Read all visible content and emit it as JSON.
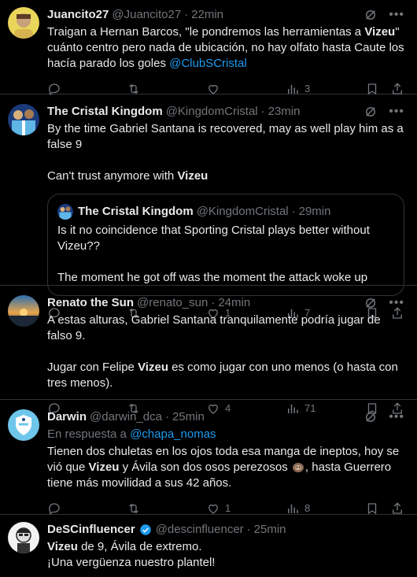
{
  "tweets": [
    {
      "name": "Juancito27",
      "handle": "@Juancito27",
      "dot": "·",
      "time": "22min",
      "text_before": "Traigan a Hernan Barcos, \"le pondremos las herramientas a ",
      "bold1": "Vizeu",
      "text_after": "\" cuánto centro pero nada de ubicación, no hay olfato hasta Caute los hacía parado los goles ",
      "link": "@ClubSCristal",
      "replies": "",
      "retweets": "",
      "likes": "",
      "views": "3"
    },
    {
      "name": "The Cristal Kingdom",
      "handle": "@KingdomCristal",
      "dot": "·",
      "time": "23min",
      "line1": "By the time Gabriel Santana is recovered, may as well play him as a false 9",
      "line2_before": "Can't trust anymore with ",
      "line2_bold": "Vizeu",
      "quote": {
        "name": "The Cristal Kingdom",
        "handle": "@KingdomCristal",
        "dot": "·",
        "time": "29min",
        "line1": "Is it no coincidence that Sporting Cristal plays better without Vizeu??",
        "line2": "The moment he got off was the moment the attack woke up"
      },
      "replies": "",
      "retweets": "",
      "likes": "1",
      "views": "7"
    },
    {
      "name": "Renato the Sun",
      "handle": "@renato_sun",
      "dot": "·",
      "time": "24min",
      "line1": "A estas alturas, Gabriel Santana tranquilamente podría jugar de falso 9.",
      "line2_before": "Jugar con Felipe ",
      "line2_bold": "Vizeu",
      "line2_after": " es como jugar con uno menos (o hasta con tres menos).",
      "replies": "",
      "retweets": "",
      "likes": "4",
      "views": "71"
    },
    {
      "name": "Darwin",
      "handle": "@darwin_dca",
      "dot": "·",
      "time": "25min",
      "reply_label": "En respuesta a ",
      "reply_handle": "@chapa_nomas",
      "text1": "Tienen dos chuletas en los ojos toda esa manga de ineptos, hoy se vió que ",
      "bold1": "Vizeu",
      "text2": " y Ávila son dos osos perezosos ",
      "text3": ", hasta Guerrero tiene más movilidad a sus 42 años.",
      "replies": "",
      "retweets": "",
      "likes": "1",
      "views": "8"
    },
    {
      "name": "DeSCinfluencer",
      "handle": "@descinfluencer",
      "dot": "·",
      "time": "25min",
      "bold1": "Vizeu",
      "text1": " de 9, Ávila de extremo.",
      "line2": "¡Una vergüenza nuestro plantel!"
    }
  ],
  "colors": {
    "background": "#000000",
    "text": "#e7e9ea",
    "muted": "#71767b",
    "link": "#1d9bf0",
    "border": "#2f3336"
  }
}
